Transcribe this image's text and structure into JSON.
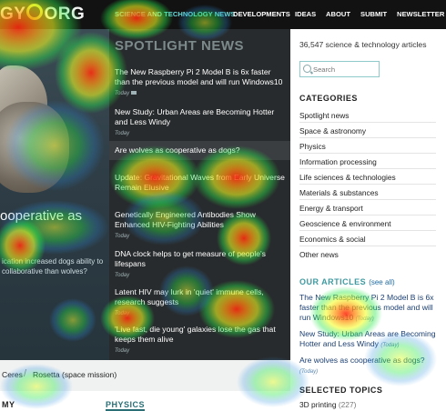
{
  "header": {
    "logo": {
      "part1": "GY",
      "part2": "ORG"
    },
    "nav": [
      {
        "label": "SCIENCE AND TECHNOLOGY NEWS",
        "active": true
      },
      {
        "label": "DEVELOPMENTS",
        "active": false
      },
      {
        "label": "IDEAS",
        "active": false
      },
      {
        "label": "ABOUT",
        "active": false
      },
      {
        "label": "SUBMIT",
        "active": false
      },
      {
        "label": "NEWSLETTER",
        "active": false
      }
    ]
  },
  "hero": {
    "headline": "ooperative as",
    "subtext": "ication increased dogs ability to collaborative than wolves?"
  },
  "spotlight": {
    "title": "SPOTLIGHT NEWS",
    "items": [
      {
        "title": "The New Raspberry Pi 2 Model B is 6x faster than the previous model and will run Windows10",
        "time": "Today"
      },
      {
        "title": "New Study: Urban Areas are Becoming Hotter and Less Windy",
        "time": "Today"
      },
      {
        "title": "Are wolves as cooperative as dogs?",
        "time": ""
      },
      {
        "title": "Update: Gravitational Waves from Early Universe Remain Elusive",
        "time": ""
      },
      {
        "title": "Genetically Engineered Antibodies Show Enhanced HIV-Fighting Abilities",
        "time": "Today"
      },
      {
        "title": "DNA clock helps to get measure of people's lifespans",
        "time": "Today"
      },
      {
        "title": "Latent HIV may lurk in 'quiet' immune cells, research suggests",
        "time": "Today"
      },
      {
        "title": "'Live fast, die young' galaxies lose the gas that keeps them alive",
        "time": "Today"
      }
    ]
  },
  "breadcrumbs": {
    "items": [
      "Ceres",
      "Rosetta (space mission)"
    ],
    "separator": "/"
  },
  "bottom": {
    "left_label": "MY",
    "physics": "PHYSICS"
  },
  "sidebar": {
    "count_text": "36,547 science & technology articles",
    "search_placeholder": "Search",
    "categories_title": "CATEGORIES",
    "categories": [
      "Spotlight news",
      "Space & astronomy",
      "Physics",
      "Information processing",
      "Life sciences & technologies",
      "Materials & substances",
      "Energy & transport",
      "Geoscience & environment",
      "Economics & social",
      "Other news"
    ],
    "our_articles_title": "OUR ARTICLES",
    "see_all": "(see all)",
    "articles": [
      {
        "title": "The New Raspberry Pi 2 Model B is 6x faster than the previous model and will run Windows10",
        "time": "(Today)"
      },
      {
        "title": "New Study: Urban Areas are Becoming Hotter and Less Windy",
        "time": "(Today)"
      },
      {
        "title": "Are wolves as cooperative as dogs?",
        "time": "(Today)"
      }
    ],
    "selected_topics_title": "SELECTED TOPICS",
    "topics": [
      {
        "label": "3D printing",
        "count": "(227)"
      }
    ]
  },
  "colors": {
    "nav_active": "#66d9d9",
    "link": "#1c3f73",
    "accent": "#3f9aa1"
  }
}
